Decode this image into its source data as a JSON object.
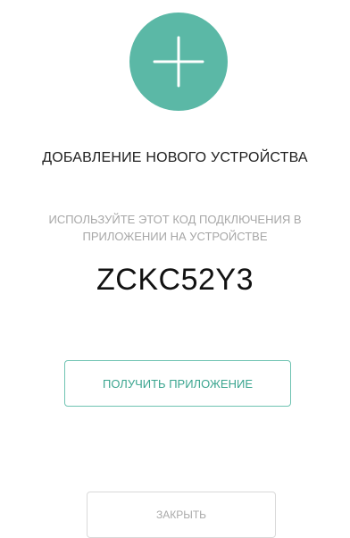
{
  "colors": {
    "accent": "#5bb8a6",
    "accent_text": "#3aa58f",
    "muted_text": "#a7a7a7",
    "close_border": "#d9d9d9"
  },
  "icon": {
    "name": "plus-icon"
  },
  "dialog": {
    "title": "ДОБАВЛЕНИЕ НОВОГО УСТРОЙСТВА",
    "instruction_line1": "ИСПОЛЬЗУЙТЕ ЭТОТ КОД ПОДКЛЮЧЕНИЯ В",
    "instruction_line2": "ПРИЛОЖЕНИИ НА УСТРОЙСТВЕ",
    "code": "ZCKC52Y3",
    "get_app_label": "ПОЛУЧИТЬ ПРИЛОЖЕНИЕ",
    "close_label": "ЗАКРЫТЬ"
  }
}
